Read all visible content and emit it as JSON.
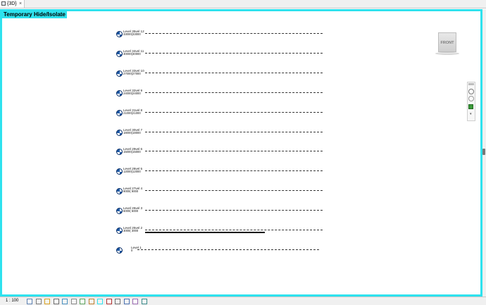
{
  "tab": {
    "label": "{3D}",
    "close": "×"
  },
  "view": {
    "mode_label": "Temporary Hide/Isolate",
    "viewcube_face": "FRONT"
  },
  "levels": [
    {
      "name": "Level 35vel 12",
      "elevation": "33000(33000"
    },
    {
      "name": "Level 34vel 11",
      "elevation": "30000(30000"
    },
    {
      "name": "Level 33vel 10",
      "elevation": "27000(27000"
    },
    {
      "name": "Level 32vel 9",
      "elevation": "24000(24000"
    },
    {
      "name": "Level 31vel 8",
      "elevation": "21000(21000"
    },
    {
      "name": "Level 30vel 7",
      "elevation": "18000(18000"
    },
    {
      "name": "Level 29vel 6",
      "elevation": "15000(15000"
    },
    {
      "name": "Level 28vel 5",
      "elevation": "12000(12000"
    },
    {
      "name": "Level 27vel 4",
      "elevation": "9000( 9000"
    },
    {
      "name": "Level 26vel 3",
      "elevation": "6000( 6000"
    },
    {
      "name": "Level 25vel 2",
      "elevation": "3000( 3000"
    },
    {
      "name": "Level 1",
      "elevation": "0"
    }
  ],
  "status": {
    "scale": "1 : 100",
    "icons": [
      "detail-level-icon",
      "visual-style-icon",
      "sun-path-icon",
      "shadows-icon",
      "render-icon",
      "crop-view-icon",
      "show-crop-icon",
      "unlock-3d-icon",
      "temporary-hide-icon",
      "reveal-hidden-icon",
      "worksharing-icon",
      "analytical-model-icon",
      "highlight-displacement-icon",
      "reveal-constraints-icon"
    ]
  },
  "colors": {
    "accent": "#2ee2ee",
    "level_head": "#1f5aa6"
  }
}
